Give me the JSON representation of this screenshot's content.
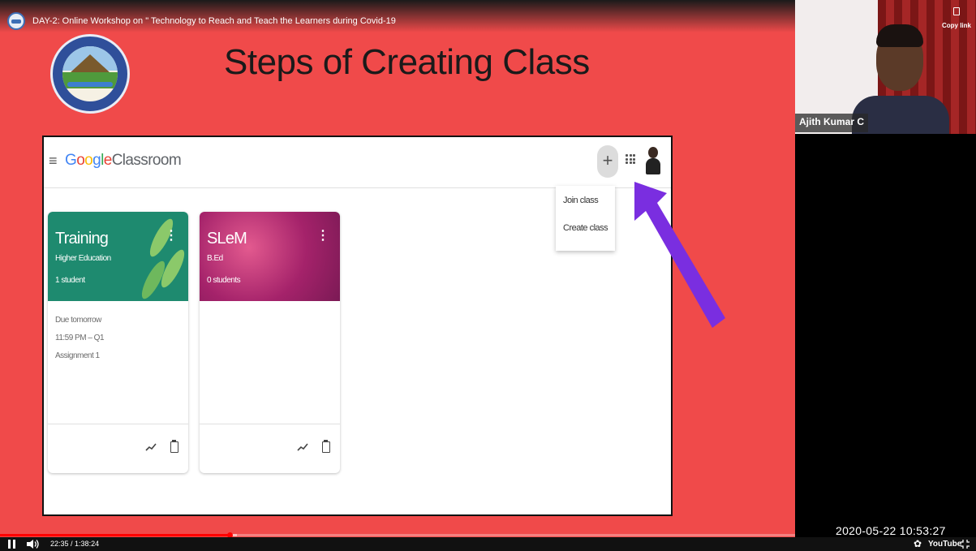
{
  "player": {
    "video_title": "DAY-2: Online Workshop on \" Technology to Reach and Teach the Learners during Covid-19",
    "progress_fraction": 0.289,
    "current_time": "22:35",
    "duration": "1:38:24",
    "time_separator": " / ",
    "settings_icon": "gear-icon",
    "youtube_label": "YouTube",
    "copy_link_label": "Copy link"
  },
  "slide": {
    "title": "Steps of Creating Class",
    "logo_icon": "university-emblem-icon",
    "background_color": "#f04a4a"
  },
  "classroom": {
    "brand_google": "Google",
    "brand_product": "Classroom",
    "menu_icon": "hamburger-icon",
    "add_icon": "+",
    "menu": {
      "items": [
        {
          "label": "Join class"
        },
        {
          "label": "Create class"
        }
      ]
    },
    "cards": [
      {
        "title": "Training",
        "section": "Higher Education",
        "count": "1 student",
        "color": "#1e8a6f",
        "due": [
          "Due tomorrow",
          "11:59 PM – Q1",
          "Assignment 1"
        ]
      },
      {
        "title": "SLeM",
        "section": "B.Ed",
        "count": "0 students",
        "color": "#a4226a",
        "due": []
      }
    ],
    "more_glyph": "⋮"
  },
  "annotation": {
    "arrow_color": "#7a2ee0"
  },
  "webcam": {
    "participant_name": "Ajith Kumar C"
  },
  "recording_timestamp": "2020-05-22 10:53:27"
}
